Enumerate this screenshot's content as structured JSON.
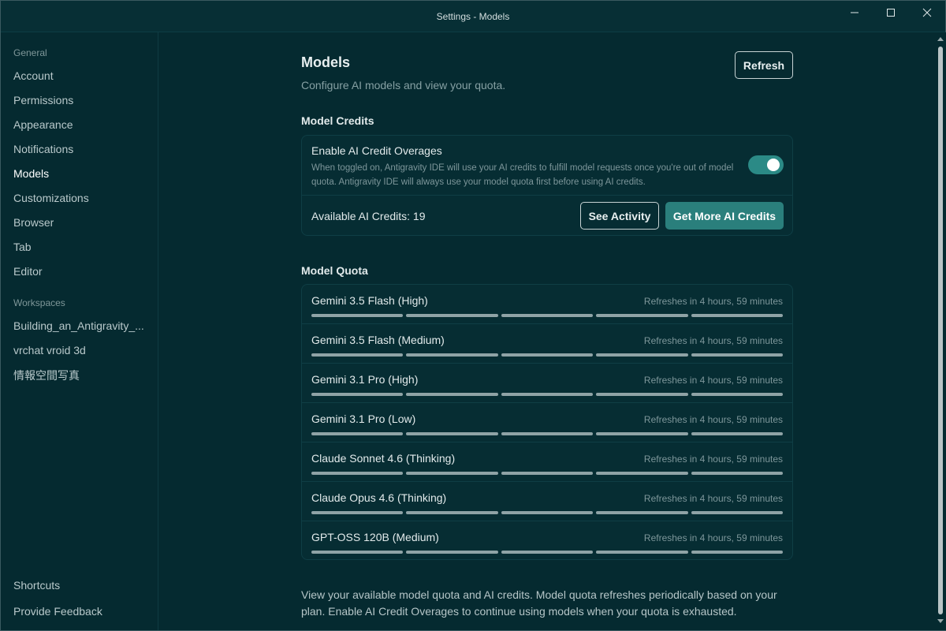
{
  "window": {
    "title": "Settings - Models"
  },
  "sidebar": {
    "general_label": "General",
    "items": [
      {
        "label": "Account"
      },
      {
        "label": "Permissions"
      },
      {
        "label": "Appearance"
      },
      {
        "label": "Notifications"
      },
      {
        "label": "Models",
        "active": true
      },
      {
        "label": "Customizations"
      },
      {
        "label": "Browser"
      },
      {
        "label": "Tab"
      },
      {
        "label": "Editor"
      }
    ],
    "workspaces_label": "Workspaces",
    "workspaces": [
      {
        "label": "Building_an_Antigravity_..."
      },
      {
        "label": "vrchat vroid 3d"
      },
      {
        "label": "情報空間写真"
      }
    ],
    "bottom_items": [
      {
        "label": "Shortcuts"
      },
      {
        "label": "Provide Feedback"
      }
    ]
  },
  "header": {
    "title": "Models",
    "subtitle": "Configure AI models and view your quota.",
    "refresh_label": "Refresh"
  },
  "credits": {
    "section_title": "Model Credits",
    "overages_title": "Enable AI Credit Overages",
    "overages_desc": "When toggled on, Antigravity IDE will use your AI credits to fulfill model requests once you're out of model quota. Antigravity IDE will always use your model quota first before using AI credits.",
    "overages_enabled": true,
    "available_label": "Available AI Credits: 19",
    "see_activity_label": "See Activity",
    "get_more_label": "Get More AI Credits"
  },
  "quota": {
    "section_title": "Model Quota",
    "models": [
      {
        "name": "Gemini 3.5 Flash (High)",
        "refresh": "Refreshes in 4 hours, 59 minutes",
        "segments_full": 5
      },
      {
        "name": "Gemini 3.5 Flash (Medium)",
        "refresh": "Refreshes in 4 hours, 59 minutes",
        "segments_full": 5
      },
      {
        "name": "Gemini 3.1 Pro (High)",
        "refresh": "Refreshes in 4 hours, 59 minutes",
        "segments_full": 5
      },
      {
        "name": "Gemini 3.1 Pro (Low)",
        "refresh": "Refreshes in 4 hours, 59 minutes",
        "segments_full": 5
      },
      {
        "name": "Claude Sonnet 4.6 (Thinking)",
        "refresh": "Refreshes in 4 hours, 59 minutes",
        "segments_full": 5
      },
      {
        "name": "Claude Opus 4.6 (Thinking)",
        "refresh": "Refreshes in 4 hours, 59 minutes",
        "segments_full": 5
      },
      {
        "name": "GPT-OSS 120B (Medium)",
        "refresh": "Refreshes in 4 hours, 59 minutes",
        "segments_full": 5
      }
    ]
  },
  "footer": {
    "note": "View your available model quota and AI credits. Model quota refreshes periodically based on your plan. Enable AI Credit Overages to continue using models when your quota is exhausted."
  },
  "colors": {
    "background": "#052a30",
    "accent": "#2a7f7c",
    "toggle_on": "#2b8a86"
  },
  "icons": [
    "minimize-icon",
    "maximize-icon",
    "close-icon"
  ]
}
